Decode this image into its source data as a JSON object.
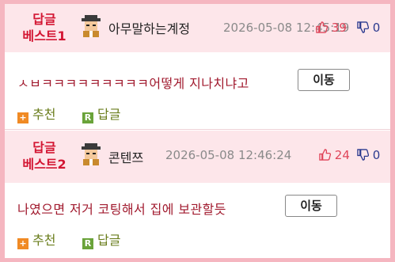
{
  "posts": [
    {
      "rank_line1": "답글",
      "rank_line2": "베스트1",
      "nickname": "아무말하는계정",
      "timestamp": "2026-05-08 12:45:19",
      "likes": "39",
      "dislikes": "0",
      "content": "ㅅㅂㅋㅋㅋㅋㅋㅋㅋㅋㅋ어떻게 지나치냐고",
      "move_label": "이동",
      "recommend_label": "추천",
      "reply_label": "답글"
    },
    {
      "rank_line1": "답글",
      "rank_line2": "베스트2",
      "nickname": "콘텐쯔",
      "timestamp": "2026-05-08 12:46:24",
      "likes": "24",
      "dislikes": "0",
      "content": "나였으면 저거 코팅해서 집에 보관할듯",
      "move_label": "이동",
      "recommend_label": "추천",
      "reply_label": "답글"
    }
  ],
  "icons": {
    "avatar": "pixel-avatar-icon",
    "like": "thumbs-up-icon",
    "dislike": "thumbs-down-icon",
    "recommend": "plus-square-icon",
    "reply": "reply-square-icon"
  },
  "colors": {
    "frame_border": "#f5b6c0",
    "header_bg": "#fde6ea",
    "rank_text": "#d31633",
    "content_text": "#a11a2e",
    "action_text": "#6a7d1c",
    "like_color": "#e0455a",
    "dislike_color": "#2b3a8f"
  }
}
